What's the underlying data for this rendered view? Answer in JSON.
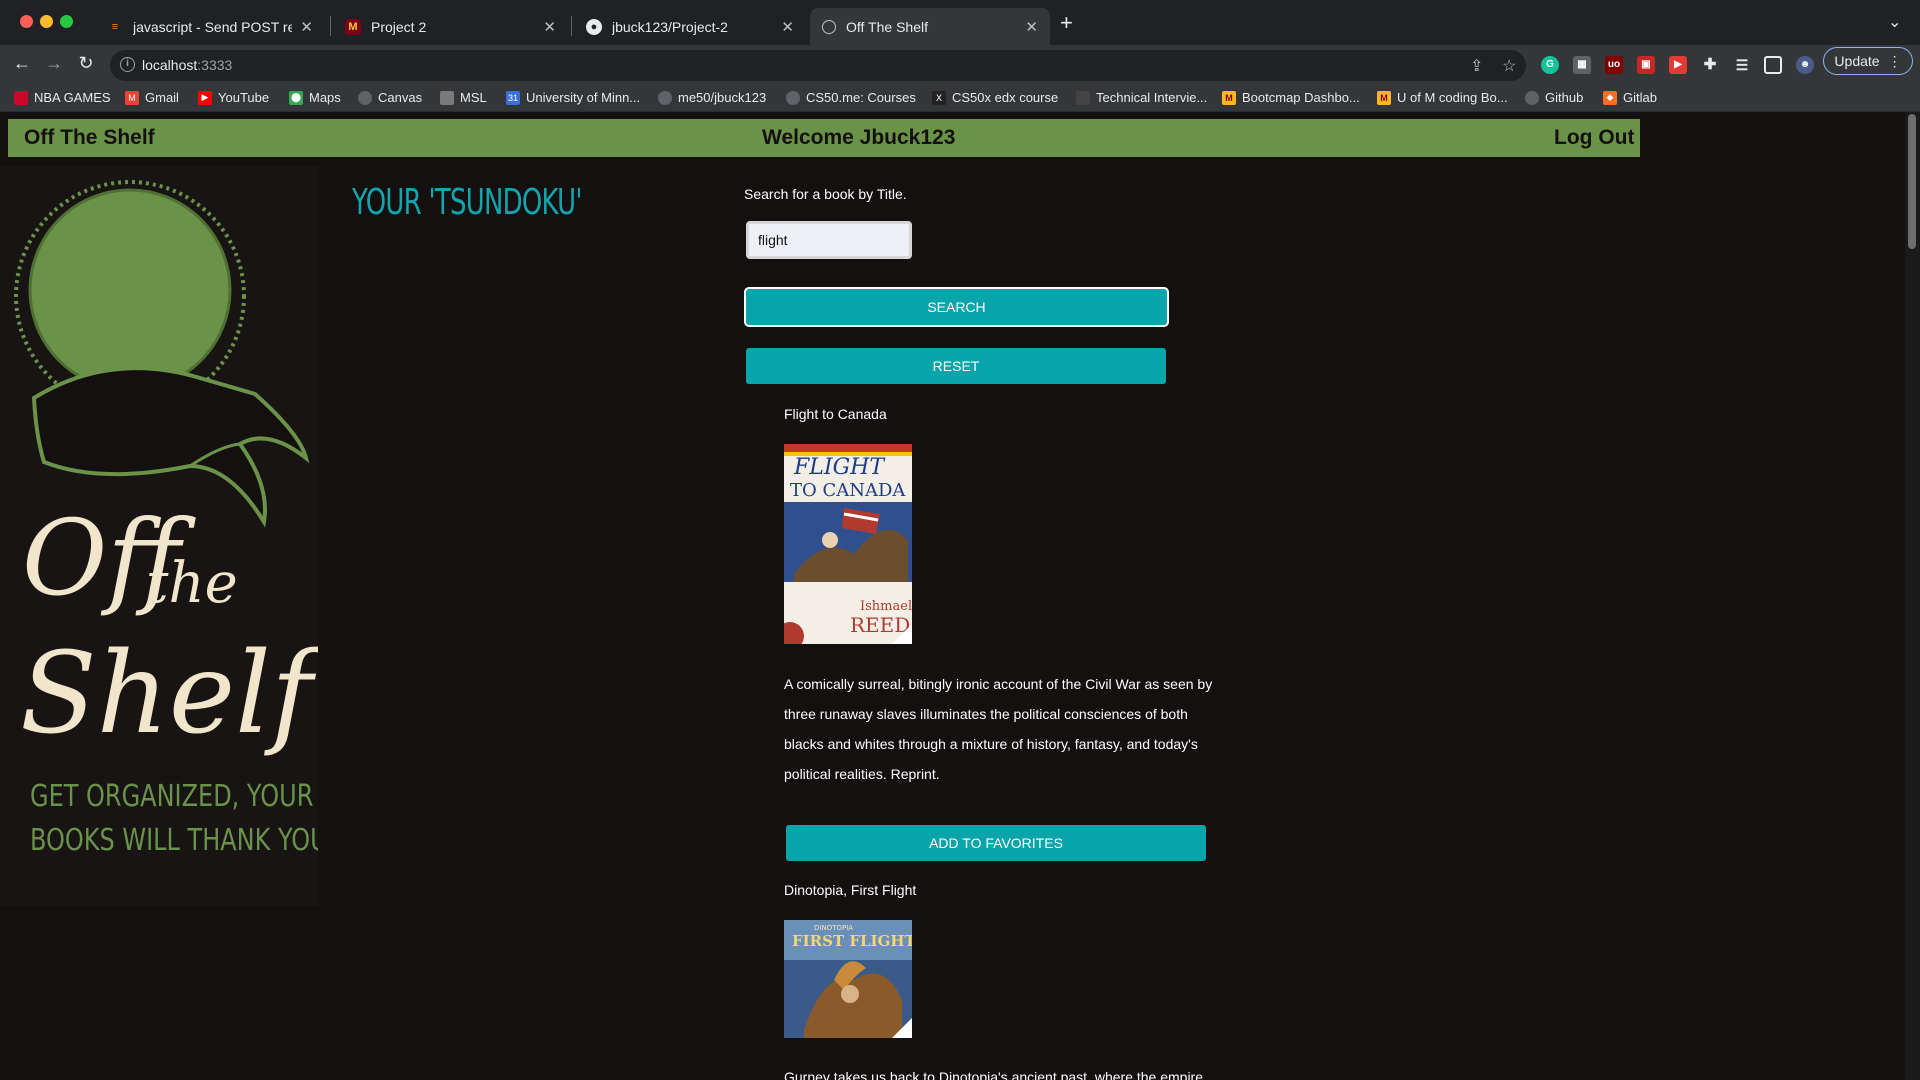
{
  "browser": {
    "tabs": [
      {
        "title": "javascript - Send POST reque…",
        "icon": "stackoverflow-icon"
      },
      {
        "title": "Project 2",
        "icon": "umn-icon"
      },
      {
        "title": "jbuck123/Project-2",
        "icon": "github-icon"
      },
      {
        "title": "Off The Shelf",
        "icon": "globe-icon"
      }
    ],
    "url": {
      "host": "localhost",
      "port": ":3333"
    },
    "update_label": "Update",
    "bookmarks": [
      {
        "label": "NBA GAMES",
        "color": "#c9082a"
      },
      {
        "label": "Gmail",
        "color": "#ea4335"
      },
      {
        "label": "YouTube",
        "color": "#ff0000"
      },
      {
        "label": "Maps",
        "color": "#34a853"
      },
      {
        "label": "Canvas",
        "color": "#5f6368"
      },
      {
        "label": "MSL",
        "color": "#7a7a7a"
      },
      {
        "label": "University of Minn...",
        "color": "#3b6fd8"
      },
      {
        "label": "me50/jbuck123",
        "color": "#5f6368"
      },
      {
        "label": "CS50.me: Courses",
        "color": "#5f6368"
      },
      {
        "label": "CS50x edx course",
        "color": "#222222"
      },
      {
        "label": "Technical Intervie...",
        "color": "#444444"
      },
      {
        "label": "Bootcmap Dashbo...",
        "color": "#ffb71e"
      },
      {
        "label": "U of M coding Bo...",
        "color": "#ffb71e"
      },
      {
        "label": "Github",
        "color": "#5f6368"
      },
      {
        "label": "Gitlab",
        "color": "#fc6d26"
      }
    ]
  },
  "app": {
    "brand": "Off The Shelf",
    "welcome": "Welcome Jbuck123",
    "logout": "Log Out",
    "logo": {
      "line1": "Off",
      "line2": "the",
      "line3": "Shelf",
      "tagline1": "GET ORGANIZED, YOUR",
      "tagline2": "BOOKS WILL THANK YOU"
    },
    "tsundoku": "YOUR 'TSUNDOKU'",
    "search": {
      "label": "Search for a book by Title.",
      "value": "flight",
      "button": "SEARCH",
      "reset": "RESET"
    },
    "results": [
      {
        "title": "Flight to Canada",
        "cover": {
          "line1": "FLIGHT",
          "line2": "TO CANADA",
          "author1": "Ishmael",
          "author2": "REED"
        },
        "description": "A comically surreal, bitingly ironic account of the Civil War as seen by three runaway slaves illuminates the political consciences of both blacks and whites through a mixture of history, fantasy, and today's political realities. Reprint.",
        "button": "ADD TO FAVORITES"
      },
      {
        "title": "Dinotopia, First Flight",
        "cover": {
          "line1": "FIRST FLIGHT",
          "line2": "DINOTOPIA"
        },
        "description": "Gurney takes us back to Dinotopia's ancient past, where the empire"
      }
    ]
  },
  "colors": {
    "accent": "#0aa5aa",
    "navbar": "#6a9249",
    "background": "#141010",
    "logo_green": "#6a9249",
    "logo_cream": "#f1e6cc"
  }
}
